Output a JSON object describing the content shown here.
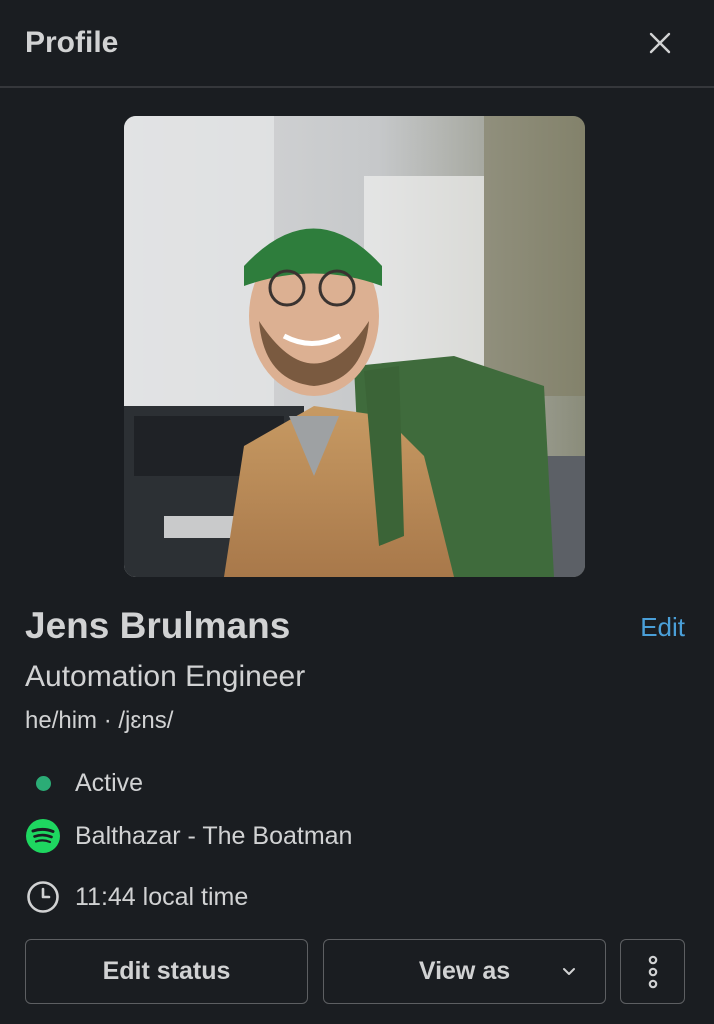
{
  "header": {
    "title": "Profile",
    "close_icon": "close-icon"
  },
  "profile": {
    "photo_alt": "Profile photo",
    "name": "Jens Brulmans",
    "edit_label": "Edit",
    "title": "Automation Engineer",
    "pronouns": "he/him · /jɛns/"
  },
  "status": {
    "presence": "Active",
    "presence_color": "#2bac76",
    "now_playing": "Balthazar - The Boatman",
    "now_playing_icon": "spotify-icon",
    "local_time": "11:44 local time",
    "local_time_icon": "clock-icon"
  },
  "actions": {
    "edit_status": "Edit status",
    "view_as": "View as",
    "more_icon": "more-vertical-icon"
  },
  "colors": {
    "background": "#1a1d21",
    "link": "#4a9fd8",
    "text": "#d1d2d3"
  }
}
